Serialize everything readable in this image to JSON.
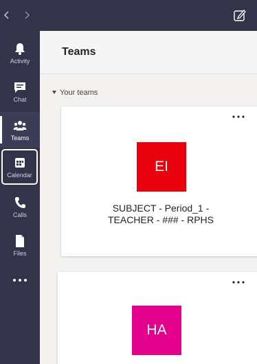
{
  "nav": {
    "back_icon": "chevron-left-icon",
    "forward_icon": "chevron-right-icon",
    "compose_icon": "compose-icon"
  },
  "rail": {
    "items": [
      {
        "label": "Activity",
        "icon": "bell-icon"
      },
      {
        "label": "Chat",
        "icon": "chat-icon"
      },
      {
        "label": "Teams",
        "icon": "teams-icon"
      },
      {
        "label": "Calendar",
        "icon": "calendar-icon"
      },
      {
        "label": "Calls",
        "icon": "phone-icon"
      },
      {
        "label": "Files",
        "icon": "file-icon"
      }
    ],
    "more_icon": "ellipsis-icon"
  },
  "header": {
    "title": "Teams"
  },
  "section": {
    "label": "Your teams"
  },
  "teams": [
    {
      "initials": "EI",
      "name": "SUBJECT - Period_1 - TEACHER - ### - RPHS",
      "color": "#e8000d"
    },
    {
      "initials": "HA",
      "name": "",
      "color": "#e3008c"
    }
  ],
  "colors": {
    "rail": "#33344a",
    "background": "#f3f2f1",
    "accent_highlight": "#ffffff"
  }
}
